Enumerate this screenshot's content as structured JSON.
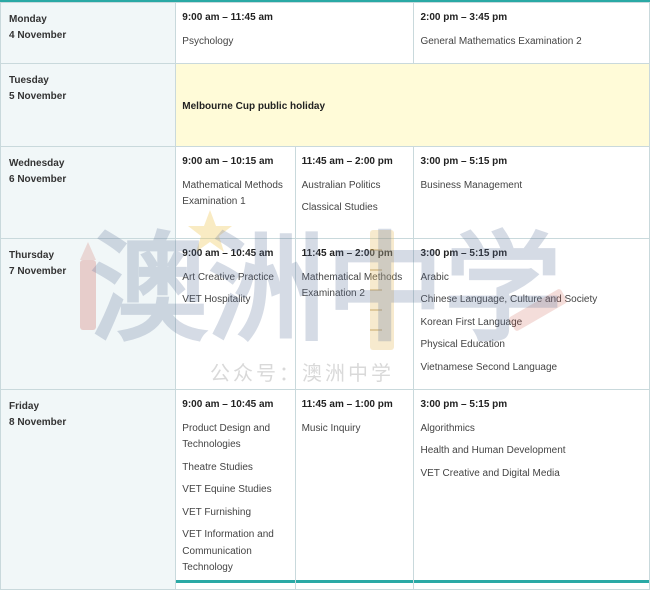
{
  "rows": [
    {
      "day": "Monday",
      "date": "4 November",
      "slots": [
        {
          "time": "9:00 am – 11:45 am",
          "subjects": [
            "Psychology"
          ]
        },
        {
          "time": "2:00 pm – 3:45 pm",
          "subjects": [
            "General Mathematics Examination 2"
          ]
        }
      ]
    },
    {
      "day": "Tuesday",
      "date": "5 November",
      "holiday": "Melbourne Cup public holiday"
    },
    {
      "day": "Wednesday",
      "date": "6 November",
      "slots": [
        {
          "time": "9:00 am – 10:15 am",
          "subjects": [
            "Mathematical Methods Examination 1"
          ]
        },
        {
          "time": "11:45 am – 2:00 pm",
          "subjects": [
            "Australian Politics",
            "Classical Studies"
          ]
        },
        {
          "time": "3:00 pm – 5:15 pm",
          "subjects": [
            "Business Management"
          ]
        }
      ]
    },
    {
      "day": "Thursday",
      "date": "7 November",
      "slots": [
        {
          "time": "9:00 am – 10:45 am",
          "subjects": [
            "Art Creative Practice",
            "VET Hospitality"
          ]
        },
        {
          "time": "11:45 am – 2:00 pm",
          "subjects": [
            "Mathematical Methods Examination 2"
          ]
        },
        {
          "time": "3:00 pm – 5:15 pm",
          "subjects": [
            "Arabic",
            "Chinese Language, Culture and Society",
            "Korean First Language",
            "Physical Education",
            "Vietnamese Second Language"
          ]
        }
      ]
    },
    {
      "day": "Friday",
      "date": "8 November",
      "slots": [
        {
          "time": "9:00 am – 10:45 am",
          "subjects": [
            "Product Design and Technologies",
            "Theatre Studies",
            "VET Equine Studies",
            "VET Furnishing",
            "VET Information and Communication Technology"
          ]
        },
        {
          "time": "11:45 am – 1:00 pm",
          "subjects": [
            "Music Inquiry"
          ]
        },
        {
          "time": "3:00 pm – 5:15 pm",
          "subjects": [
            "Algorithmics",
            "Health and Human Development",
            "VET Creative and Digital Media"
          ]
        }
      ]
    }
  ],
  "watermark": {
    "logo_text": "澳洲中学",
    "caption": "公众号：澳洲中学"
  },
  "colors": {
    "accent": "#2aa9a5",
    "holiday_bg": "#fffbd8",
    "day_bg": "#f1f7f8",
    "border": "#c9d9dc"
  }
}
